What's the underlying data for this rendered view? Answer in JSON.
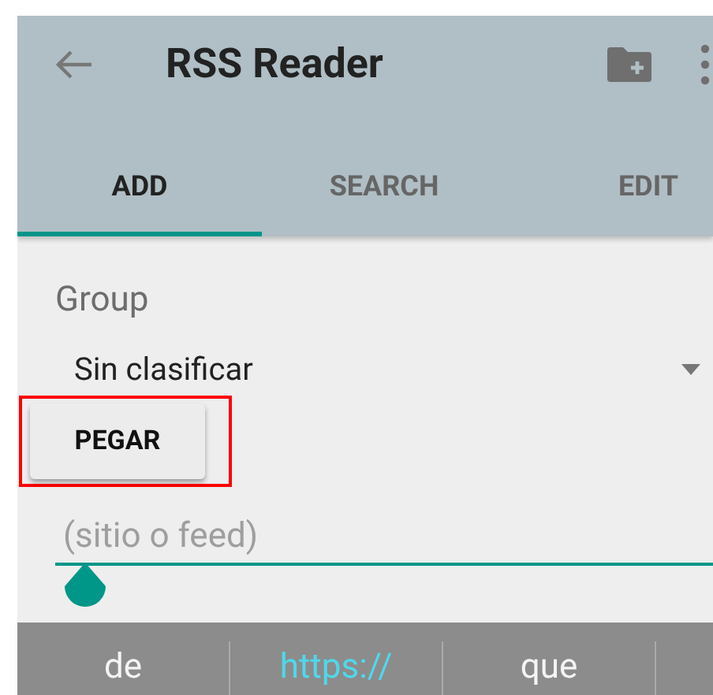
{
  "toolbar": {
    "title": "RSS Reader"
  },
  "tabs": [
    {
      "label": "ADD",
      "selected": true
    },
    {
      "label": "SEARCH",
      "selected": false
    },
    {
      "label": "EDIT",
      "selected": false
    }
  ],
  "group": {
    "label": "Group",
    "value": "Sin clasificar"
  },
  "paste_button": {
    "label": "PEGAR",
    "highlighted": true
  },
  "url_field": {
    "placeholder": "(sitio o feed)"
  },
  "suggestions": [
    {
      "label": "de",
      "selected": false
    },
    {
      "label": "https://",
      "selected": true
    },
    {
      "label": "que",
      "selected": false
    }
  ]
}
